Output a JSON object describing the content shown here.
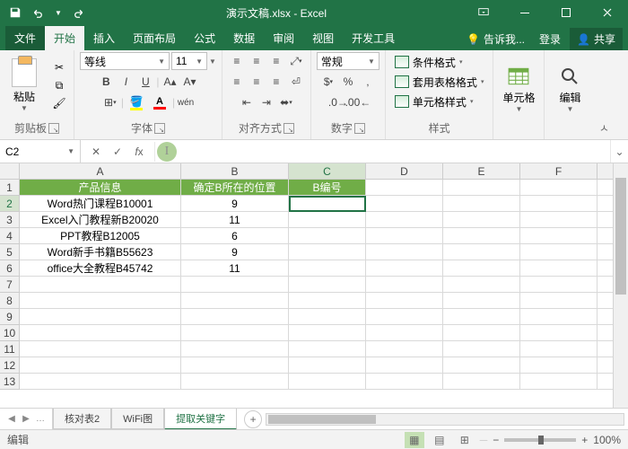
{
  "titlebar": {
    "title": "演示文稿.xlsx - Excel"
  },
  "tabs": {
    "file": "文件",
    "home": "开始",
    "insert": "插入",
    "layout": "页面布局",
    "formula": "公式",
    "data": "数据",
    "review": "审阅",
    "view": "视图",
    "dev": "开发工具",
    "tell": "告诉我...",
    "signin": "登录",
    "share": "共享"
  },
  "ribbon": {
    "clipboard": {
      "paste": "粘贴",
      "label": "剪贴板"
    },
    "font": {
      "name": "等线",
      "size": "11",
      "label": "字体"
    },
    "align": {
      "label": "对齐方式"
    },
    "number": {
      "format": "常规",
      "label": "数字"
    },
    "styles": {
      "cond": "条件格式",
      "table": "套用表格格式",
      "cell": "单元格样式",
      "label": "样式"
    },
    "cells": {
      "label": "单元格"
    },
    "editing": {
      "label": "编辑"
    }
  },
  "fbar": {
    "ref": "C2"
  },
  "headers": [
    "A",
    "B",
    "C",
    "D",
    "E",
    "F"
  ],
  "row1": {
    "A": "产品信息",
    "B": "确定B所在的位置",
    "C": "B编号"
  },
  "rows": [
    {
      "n": "2",
      "A": "Word热门课程B10001",
      "B": "9"
    },
    {
      "n": "3",
      "A": "Excel入门教程新B20020",
      "B": "11"
    },
    {
      "n": "4",
      "A": "PPT教程B12005",
      "B": "6"
    },
    {
      "n": "5",
      "A": "Word新手书籍B55623",
      "B": "9"
    },
    {
      "n": "6",
      "A": "office大全教程B45742",
      "B": "11"
    }
  ],
  "sheets": {
    "s1": "核对表2",
    "s2": "WiFi图",
    "s3": "提取关键字"
  },
  "status": {
    "mode": "编辑",
    "zoom": "100%"
  }
}
